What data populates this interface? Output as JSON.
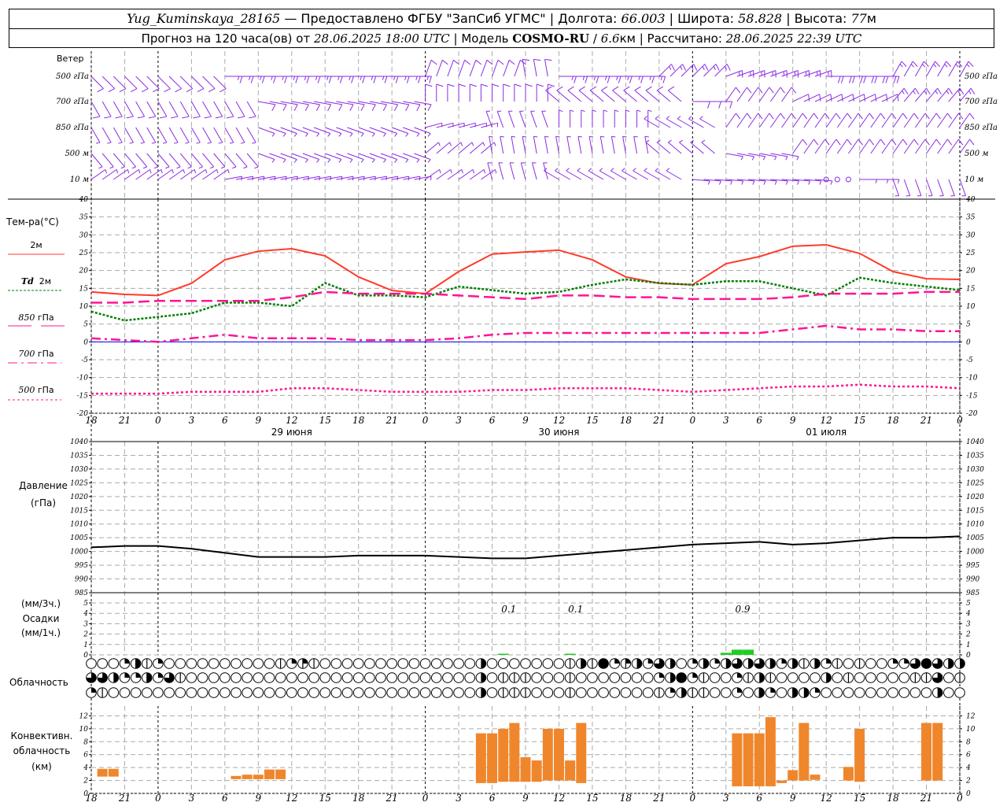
{
  "header": {
    "station": "Yug_Kuminskaya_28165",
    "provider": " — Предоставлено ФГБУ \"ЗапСиб УГМС\" | Долгота: ",
    "lon": "66.003",
    "lat_label": " | Широта: ",
    "lat": "58.828",
    "alt_label": " | Высота: ",
    "alt": "77",
    "alt_unit": "м",
    "forecast_label": "Прогноз на 120 часа(ов) от ",
    "forecast_start": "28.06.2025 18:00 UTC",
    "model_label": " | Модель ",
    "model": "COSMO-RU",
    "model_sep": " / ",
    "resolution": "6.6",
    "res_unit": "км",
    "computed_label": " | Рассчитано: ",
    "computed": "28.06.2025 22:39 UTC"
  },
  "labels": {
    "wind": "Ветер",
    "wind_levels": [
      "500 гПа",
      "700 гПа",
      "850 гПа",
      "500 м",
      "10 м"
    ],
    "temp": "Тем-ра(°C)",
    "legend_2m": "2м",
    "legend_td": "Td",
    "legend_td_unit": "2м",
    "legend_850": "850",
    "legend_700": "700",
    "legend_500": "500",
    "legend_hpa": "гПа",
    "pressure": "Давление",
    "pressure_unit": "(гПа)",
    "precip_3h": "(мм/3ч.)",
    "precip": "Осадки",
    "precip_1h": "(мм/1ч.)",
    "clouds": "Облачность",
    "conv1": "Конвективн.",
    "conv2": "облачность",
    "conv3": "(км)"
  },
  "colors": {
    "t2m": "#ff3a2a",
    "td2m": "#008000",
    "t850": "#ff1493",
    "t700": "#ff1493",
    "t500": "#ff1493",
    "wind": "#8a2be2",
    "pressure": "#000000",
    "precip": "#22cc22",
    "convective": "#f0862c",
    "zero_line": "#0000ff",
    "grid": "#aaaaaa"
  },
  "chart_data": {
    "type": "line",
    "time_axis": {
      "hour_labels": [
        "18",
        "21",
        "0",
        "3",
        "6",
        "9",
        "12",
        "15",
        "18",
        "21",
        "0",
        "3",
        "6",
        "9",
        "12",
        "15",
        "18",
        "21",
        "0",
        "3",
        "6",
        "9",
        "12",
        "15",
        "18",
        "21",
        "0"
      ],
      "date_labels": [
        "29 июня",
        "30 июня",
        "01 июля"
      ],
      "step_hours": 3
    },
    "temperature": {
      "ylim": [
        -20,
        40
      ],
      "ticks": [
        40,
        35,
        30,
        25,
        20,
        15,
        10,
        5,
        0,
        -5,
        -10,
        -15,
        -20
      ],
      "series": [
        {
          "name": "2м",
          "key": "t2m",
          "values": [
            14,
            13.3,
            13,
            16.4,
            23,
            25.4,
            26.1,
            24.1,
            18.2,
            14.4,
            13.5,
            19.7,
            24.6,
            25.2,
            25.7,
            23,
            18.2,
            16.4,
            16,
            21.9,
            23.9,
            26.8,
            27.2,
            24.8,
            19.7,
            17.7,
            17.5
          ]
        },
        {
          "name": "Td 2м",
          "key": "td2m",
          "values": [
            8.5,
            6,
            7,
            8,
            11,
            11,
            10,
            16.5,
            13,
            13,
            12.5,
            15.5,
            14.5,
            13.5,
            14,
            16,
            17.5,
            16.5,
            16,
            17,
            17,
            15,
            13,
            18,
            16.5,
            15.5,
            14.5
          ]
        },
        {
          "name": "850 гПа",
          "key": "t850",
          "values": [
            11,
            11,
            11.5,
            11.5,
            11.5,
            11.5,
            12.5,
            14,
            13.5,
            13.5,
            13.5,
            13,
            12.5,
            12,
            13,
            13,
            12.5,
            12.5,
            12,
            12,
            12,
            12.5,
            13.5,
            13.5,
            13.5,
            14,
            14
          ]
        },
        {
          "name": "700 гПа",
          "key": "t700",
          "values": [
            1,
            0.5,
            0,
            1,
            2,
            1,
            1,
            1,
            0.5,
            0.5,
            0.5,
            1,
            2,
            2.5,
            2.5,
            2.5,
            2.5,
            2.5,
            2.5,
            2.5,
            2.5,
            3.5,
            4.5,
            3.5,
            3.5,
            3,
            3
          ]
        },
        {
          "name": "500 гПа",
          "key": "t500",
          "values": [
            -14.5,
            -14.5,
            -14.5,
            -14,
            -14,
            -14,
            -13,
            -13,
            -13.5,
            -14,
            -14,
            -14,
            -13.5,
            -13.5,
            -13,
            -13,
            -13,
            -13.5,
            -14,
            -13.5,
            -13,
            -12.5,
            -12.5,
            -12,
            -12.5,
            -12.5,
            -13
          ]
        }
      ]
    },
    "pressure": {
      "ylim": [
        985,
        1040
      ],
      "ticks": [
        1040,
        1035,
        1030,
        1025,
        1020,
        1015,
        1010,
        1005,
        1000,
        995,
        990,
        985
      ],
      "values": [
        1001.5,
        1002,
        1002,
        1001,
        999.5,
        998,
        998,
        998,
        998.5,
        998.5,
        998.5,
        998,
        997.5,
        997.5,
        998.5,
        999.5,
        1000.5,
        1001.5,
        1002.5,
        1003,
        1003.5,
        1002.5,
        1003,
        1004,
        1005,
        1005,
        1005.5
      ]
    },
    "precipitation": {
      "ylim": [
        0,
        5
      ],
      "ticks": [
        5,
        4,
        3,
        2,
        1,
        0
      ],
      "hourly": [
        {
          "hour": 37,
          "value": 0.1
        },
        {
          "hour": 43,
          "value": 0.05
        },
        {
          "hour": 57,
          "value": 0.2
        },
        {
          "hour": 58,
          "value": 0.5
        },
        {
          "hour": 59,
          "value": 0.5
        }
      ],
      "sum_labels": [
        {
          "hour": 37.5,
          "text": "0.1"
        },
        {
          "hour": 43.5,
          "text": "0.1"
        },
        {
          "hour": 58.5,
          "text": "0.9"
        }
      ]
    },
    "cloud_cover_eighths": {
      "upper": [
        0,
        0,
        0,
        2,
        5,
        1,
        2,
        0,
        0,
        0,
        0,
        0,
        0,
        0,
        0,
        0,
        0,
        1,
        2,
        3,
        1,
        0,
        0,
        0,
        0,
        0,
        0,
        0,
        0,
        0,
        0,
        0,
        0,
        0,
        0,
        4,
        0,
        0,
        0,
        0,
        0,
        0,
        0,
        1,
        5,
        1,
        8,
        2,
        3,
        4,
        2,
        6,
        4,
        0,
        2,
        5,
        2,
        4,
        6,
        4,
        6,
        5,
        2,
        5,
        1,
        5,
        2,
        1,
        0,
        1,
        0,
        0,
        2,
        2,
        6,
        8,
        6,
        5,
        4
      ],
      "middle": [
        6,
        6,
        4,
        2,
        2,
        5,
        2,
        6,
        1,
        0,
        0,
        0,
        0,
        0,
        0,
        0,
        0,
        0,
        0,
        0,
        0,
        0,
        0,
        0,
        0,
        0,
        0,
        0,
        0,
        0,
        0,
        0,
        0,
        0,
        0,
        4,
        0,
        1,
        1,
        1,
        0,
        0,
        0,
        1,
        0,
        0,
        0,
        0,
        0,
        0,
        0,
        2,
        4,
        8,
        2,
        1,
        0,
        0,
        2,
        1,
        4,
        1,
        0,
        0,
        0,
        0,
        4,
        0,
        1,
        0,
        0,
        0,
        0,
        0,
        1,
        1,
        6,
        0,
        1
      ],
      "lower": [
        2,
        1,
        0,
        0,
        0,
        0,
        0,
        0,
        0,
        0,
        0,
        0,
        0,
        0,
        0,
        0,
        0,
        0,
        0,
        0,
        0,
        0,
        0,
        0,
        0,
        0,
        0,
        0,
        0,
        0,
        0,
        0,
        0,
        0,
        0,
        4,
        0,
        1,
        1,
        1,
        0,
        0,
        0,
        1,
        0,
        0,
        0,
        0,
        0,
        0,
        0,
        1,
        2,
        4,
        1,
        1,
        0,
        0,
        2,
        0,
        5,
        2,
        0,
        5,
        4,
        2,
        0,
        0,
        0,
        0,
        0,
        0,
        0,
        0,
        0,
        0,
        4,
        0,
        0
      ]
    },
    "convective_cloud_km": {
      "ylim": [
        0,
        13
      ],
      "ticks": [
        12,
        10,
        8,
        6,
        4,
        2,
        0
      ],
      "bars": [
        {
          "hour": 1,
          "base": 2.6,
          "top": 3.8
        },
        {
          "hour": 2,
          "base": 2.6,
          "top": 3.8
        },
        {
          "hour": 13,
          "base": 2.2,
          "top": 2.7
        },
        {
          "hour": 14,
          "base": 2.2,
          "top": 2.9
        },
        {
          "hour": 15,
          "base": 2.2,
          "top": 2.9
        },
        {
          "hour": 16,
          "base": 2.2,
          "top": 3.7
        },
        {
          "hour": 17,
          "base": 2.2,
          "top": 3.7
        },
        {
          "hour": 35,
          "base": 1.6,
          "top": 9.3
        },
        {
          "hour": 36,
          "base": 1.6,
          "top": 9.3
        },
        {
          "hour": 37,
          "base": 1.8,
          "top": 10
        },
        {
          "hour": 38,
          "base": 1.8,
          "top": 10.9
        },
        {
          "hour": 39,
          "base": 1.8,
          "top": 5.6
        },
        {
          "hour": 40,
          "base": 1.8,
          "top": 5.1
        },
        {
          "hour": 41,
          "base": 2,
          "top": 10
        },
        {
          "hour": 42,
          "base": 2,
          "top": 10
        },
        {
          "hour": 43,
          "base": 2,
          "top": 5.1
        },
        {
          "hour": 44,
          "base": 1.6,
          "top": 10.9
        },
        {
          "hour": 58,
          "base": 1.1,
          "top": 9.3
        },
        {
          "hour": 59,
          "base": 1.1,
          "top": 9.3
        },
        {
          "hour": 60,
          "base": 1.1,
          "top": 9.3
        },
        {
          "hour": 61,
          "base": 1.1,
          "top": 11.8
        },
        {
          "hour": 62,
          "base": 1.6,
          "top": 2
        },
        {
          "hour": 63,
          "base": 2,
          "top": 3.6
        },
        {
          "hour": 64,
          "base": 2,
          "top": 10.9
        },
        {
          "hour": 65,
          "base": 2.1,
          "top": 2.9
        },
        {
          "hour": 68,
          "base": 2,
          "top": 4.1
        },
        {
          "hour": 69,
          "base": 1.8,
          "top": 10
        },
        {
          "hour": 75,
          "base": 2,
          "top": 10.9
        },
        {
          "hour": 76,
          "base": 2,
          "top": 10.9
        }
      ]
    },
    "wind": {
      "levels": [
        "500 гПа",
        "700 гПа",
        "850 гПа",
        "500 м",
        "10 м"
      ],
      "direction_deg": [
        [
          135,
          135,
          135,
          135,
          90,
          90,
          90,
          90,
          90,
          90,
          20,
          20,
          20,
          350,
          90,
          90,
          90,
          45,
          45,
          70,
          70,
          70,
          90,
          90,
          30,
          30,
          30
        ],
        [
          150,
          150,
          150,
          150,
          150,
          100,
          100,
          100,
          100,
          100,
          0,
          0,
          0,
          0,
          310,
          310,
          310,
          310,
          90,
          35,
          35,
          65,
          65,
          65,
          40,
          40,
          40
        ],
        [
          150,
          150,
          150,
          150,
          150,
          110,
          110,
          110,
          110,
          110,
          75,
          75,
          340,
          340,
          0,
          0,
          0,
          300,
          300,
          35,
          35,
          35,
          35,
          35,
          35,
          35,
          35
        ],
        [
          140,
          140,
          140,
          140,
          140,
          110,
          110,
          110,
          110,
          110,
          50,
          50,
          350,
          350,
          350,
          350,
          350,
          310,
          310,
          100,
          100,
          35,
          35,
          35,
          35,
          35,
          35
        ],
        [
          55,
          55,
          55,
          55,
          80,
          80,
          80,
          80,
          80,
          80,
          55,
          55,
          345,
          345,
          300,
          300,
          300,
          300,
          95,
          95,
          95,
          95,
          0,
          90,
          160,
          160,
          160
        ]
      ],
      "speed_ms": [
        [
          10,
          10,
          10,
          10,
          15,
          15,
          15,
          15,
          15,
          15,
          10,
          10,
          10,
          10,
          15,
          15,
          15,
          15,
          15,
          15,
          15,
          15,
          20,
          20,
          15,
          15,
          15
        ],
        [
          10,
          10,
          10,
          10,
          10,
          10,
          10,
          10,
          10,
          10,
          10,
          10,
          10,
          10,
          10,
          10,
          10,
          10,
          10,
          10,
          10,
          10,
          10,
          10,
          15,
          15,
          15
        ],
        [
          7,
          7,
          7,
          7,
          7,
          7,
          7,
          7,
          7,
          7,
          7,
          7,
          7,
          7,
          7,
          7,
          7,
          7,
          7,
          10,
          10,
          10,
          10,
          10,
          10,
          10,
          10
        ],
        [
          7,
          7,
          7,
          7,
          7,
          7,
          7,
          7,
          7,
          7,
          7,
          7,
          7,
          7,
          7,
          7,
          7,
          7,
          7,
          7,
          7,
          10,
          10,
          10,
          10,
          10,
          10
        ],
        [
          4,
          4,
          4,
          4,
          5,
          5,
          5,
          5,
          5,
          5,
          4,
          4,
          4,
          4,
          4,
          4,
          4,
          4,
          5,
          5,
          5,
          5,
          0,
          4,
          5,
          5,
          5
        ]
      ]
    }
  }
}
